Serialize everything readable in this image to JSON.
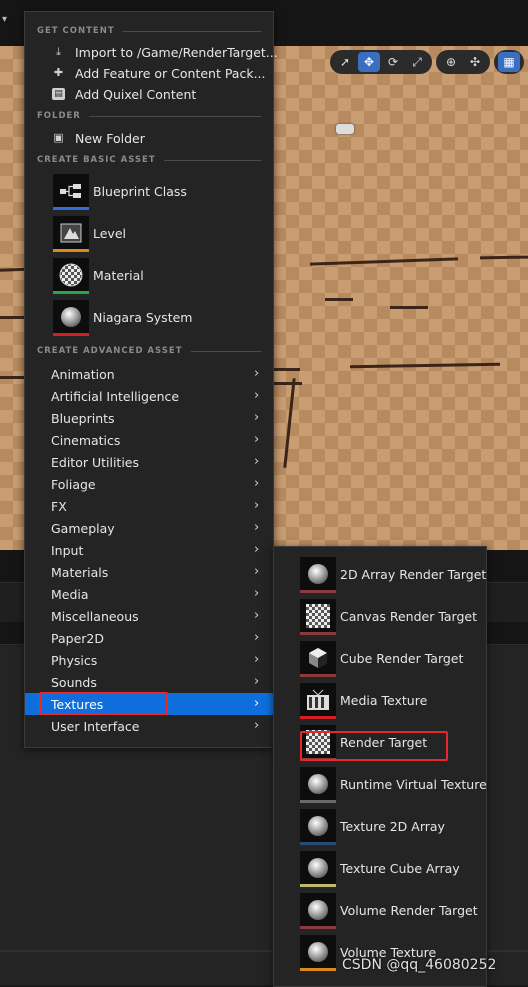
{
  "main_menu": {
    "sections": {
      "get_content": "GET CONTENT",
      "folder": "FOLDER",
      "create_basic": "CREATE BASIC ASSET",
      "create_advanced": "CREATE ADVANCED ASSET"
    },
    "get_content_items": [
      {
        "label": "Import to /Game/RenderTarget...",
        "icon": "import-icon"
      },
      {
        "label": "Add Feature or Content Pack...",
        "icon": "content-pack-icon"
      },
      {
        "label": "Add Quixel Content",
        "icon": "quixel-icon"
      }
    ],
    "folder_items": [
      {
        "label": "New Folder",
        "icon": "new-folder-icon"
      }
    ],
    "basic_assets": [
      {
        "label": "Blueprint Class",
        "icon": "blueprint-icon",
        "color": "#2f6fd6"
      },
      {
        "label": "Level",
        "icon": "level-icon",
        "color": "#d98a1a"
      },
      {
        "label": "Material",
        "icon": "material-icon",
        "color": "#2aa64a"
      },
      {
        "label": "Niagara System",
        "icon": "niagara-icon",
        "color": "#d22020"
      }
    ],
    "categories": [
      "Animation",
      "Artificial Intelligence",
      "Blueprints",
      "Cinematics",
      "Editor Utilities",
      "Foliage",
      "FX",
      "Gameplay",
      "Input",
      "Materials",
      "Media",
      "Miscellaneous",
      "Paper2D",
      "Physics",
      "Sounds",
      "Textures",
      "User Interface"
    ],
    "selected_category": "Textures"
  },
  "submenu": {
    "items": [
      {
        "label": "2D Array Render Target",
        "icon": "sphere-icon",
        "color": "#8a3a3a"
      },
      {
        "label": "Canvas Render Target",
        "icon": "checker-icon",
        "color": "#8a3a3a"
      },
      {
        "label": "Cube Render Target",
        "icon": "cube-icon",
        "color": "#8a3a3a"
      },
      {
        "label": "Media Texture",
        "icon": "tv-icon",
        "color": "#d22020"
      },
      {
        "label": "Render Target",
        "icon": "checker-icon",
        "color": "#8a3a3a"
      },
      {
        "label": "Runtime Virtual Texture",
        "icon": "sphere-icon",
        "color": "#6a6a6a"
      },
      {
        "label": "Texture 2D Array",
        "icon": "sphere-icon",
        "color": "#2a4a7a"
      },
      {
        "label": "Texture Cube Array",
        "icon": "sphere-icon",
        "color": "#bfb870"
      },
      {
        "label": "Volume Render Target",
        "icon": "sphere-icon",
        "color": "#8a3a3a"
      },
      {
        "label": "Volume Texture",
        "icon": "sphere-icon",
        "color": "#d98a1a"
      }
    ],
    "highlighted": "Render Target"
  },
  "viewport_toolbar": {
    "buttons": [
      "select-icon",
      "translate-icon",
      "rotate-icon",
      "scale-icon",
      "globe-icon",
      "snap-icon",
      "grid-icon"
    ],
    "active": "translate-icon"
  },
  "watermark": "CSDN @qq_46080252"
}
